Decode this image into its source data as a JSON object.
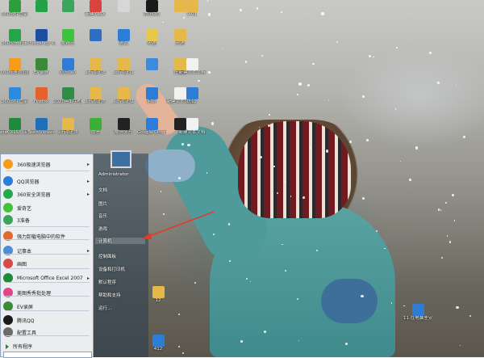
{
  "desktop": {
    "icons": [
      {
        "label": "360软件管家",
        "color": "#2e9e3a"
      },
      {
        "label": "360安全卫士",
        "color": "#23a548"
      },
      {
        "label": "360极速浏览器",
        "color": "#f59d1b"
      },
      {
        "label": "360软件管家",
        "color": "#2b8be0"
      },
      {
        "label": "新建 XLSX 工作表",
        "color": "#1e8a3c"
      },
      {
        "label": "",
        "color": "#24a24a"
      },
      {
        "label": "Photoshop CS6",
        "color": "#1d4f9e"
      },
      {
        "label": "EV录屏",
        "color": "#3a8a3a"
      },
      {
        "label": "Firefox",
        "color": "#e5622a"
      },
      {
        "label": "TeamViewer",
        "color": "#1f6fb8"
      },
      {
        "label": "",
        "color": "#3ba55c"
      },
      {
        "label": "爱奇艺",
        "color": "#3cc43c"
      },
      {
        "label": "必应(ai)",
        "color": "#2b7dd6"
      },
      {
        "label": "2020年1月考勤表",
        "color": "#2f8d46"
      },
      {
        "label": "上传临时5",
        "color": "#e6b84a"
      },
      {
        "label": "新建XLSX",
        "color": "#d9423d"
      },
      {
        "label": "",
        "color": "#2e6fc4"
      },
      {
        "label": "上传临时8",
        "color": "#e6b84a"
      },
      {
        "label": "上传临时5",
        "color": "#e6b84a"
      },
      {
        "label": "微信",
        "color": "#3cb034"
      },
      {
        "label": "",
        "color": "#d7d7d7"
      },
      {
        "label": "测试",
        "color": "#2b7dd6"
      },
      {
        "label": "上传临时1",
        "color": "#e6b84a"
      },
      {
        "label": "上传临时2",
        "color": "#e6b84a"
      },
      {
        "label": "酷狗多开",
        "color": "#222"
      },
      {
        "label": "腾讯QQ",
        "color": "#1a1a1a"
      },
      {
        "label": "天涯",
        "color": "#e6c84a"
      },
      {
        "label": "",
        "color": "#3b8be0"
      },
      {
        "label": "网络",
        "color": "#2b7dd6"
      },
      {
        "label": "Google Chrome",
        "color": "#2e7be0"
      },
      {
        "label": "",
        "color": "#e6b84a"
      },
      {
        "label": "天涯",
        "color": "#e6b84a"
      },
      {
        "label": "压缩1",
        "color": "#e6b84a"
      },
      {
        "label": "新建文本文档",
        "color": "#f2f2f2"
      },
      {
        "label": "",
        "color": "#222"
      },
      {
        "label": "9.01",
        "color": "#e6b84a"
      },
      {
        "label": "新建文本文档",
        "color": "#f2f2f2"
      },
      {
        "label": "0.12",
        "color": "#2b7dd6"
      },
      {
        "label": "新建文本文档",
        "color": "#f2f2f2"
      },
      {
        "label": "12",
        "color": "#e6b84a"
      },
      {
        "label": "412",
        "color": "#2b7dd6"
      },
      {
        "label": "11.在电脑里安装软件",
        "color": "#2b7dd6"
      }
    ]
  },
  "start_menu": {
    "left_items": [
      {
        "label": "360极速浏览器",
        "has_arrow": true,
        "icon": "globe-green-icon",
        "color": "#f59d1b"
      },
      {
        "label": "QQ浏览器",
        "has_arrow": true,
        "icon": "qq-browser-icon",
        "color": "#2b7dd6"
      },
      {
        "label": "360安全浏览器",
        "has_arrow": true,
        "icon": "shield-browser-icon",
        "color": "#25a84a"
      },
      {
        "label": "爱奇艺",
        "has_arrow": false,
        "icon": "iqiyi-icon",
        "color": "#44c13a"
      },
      {
        "label": "3准备",
        "has_arrow": false,
        "icon": "folder-icon",
        "color": "#3ba55c"
      },
      {
        "label": "强力卸载电脑中的软件",
        "has_arrow": false,
        "icon": "uninstall-icon",
        "color": "#e06a2a"
      },
      {
        "label": "记事本",
        "has_arrow": true,
        "icon": "notepad-icon",
        "color": "#4a8fd6"
      },
      {
        "label": "画图",
        "has_arrow": false,
        "icon": "paint-icon",
        "color": "#d64a4a"
      },
      {
        "label": "Microsoft Office Excel 2007",
        "has_arrow": true,
        "icon": "excel-icon",
        "color": "#1e8a3c"
      },
      {
        "label": "美图秀秀批处理",
        "has_arrow": false,
        "icon": "meitu-icon",
        "color": "#e0458a"
      },
      {
        "label": "EV录屏",
        "has_arrow": false,
        "icon": "ev-icon",
        "color": "#3a8a3a"
      },
      {
        "label": "腾讯QQ",
        "has_arrow": false,
        "icon": "qq-icon",
        "color": "#1a1a1a"
      },
      {
        "label": "配置工具",
        "has_arrow": false,
        "icon": "tool-icon",
        "color": "#6b6b6b"
      }
    ],
    "all_programs": "所有程序",
    "right_items": [
      {
        "label": "Administrator",
        "selected": false
      },
      {
        "label": "文档",
        "selected": false
      },
      {
        "label": "图片",
        "selected": false
      },
      {
        "label": "音乐",
        "selected": false
      },
      {
        "label": "游戏",
        "selected": false
      },
      {
        "label": "计算机",
        "selected": true
      },
      {
        "label": "控制面板",
        "selected": false
      },
      {
        "label": "设备和打印机",
        "selected": false
      },
      {
        "label": "默认程序",
        "selected": false
      },
      {
        "label": "帮助和支持",
        "selected": false
      },
      {
        "label": "运行...",
        "selected": false
      }
    ]
  },
  "colors": {
    "arrow": "#e23a2a",
    "menu_border": "#8ea5bd"
  }
}
